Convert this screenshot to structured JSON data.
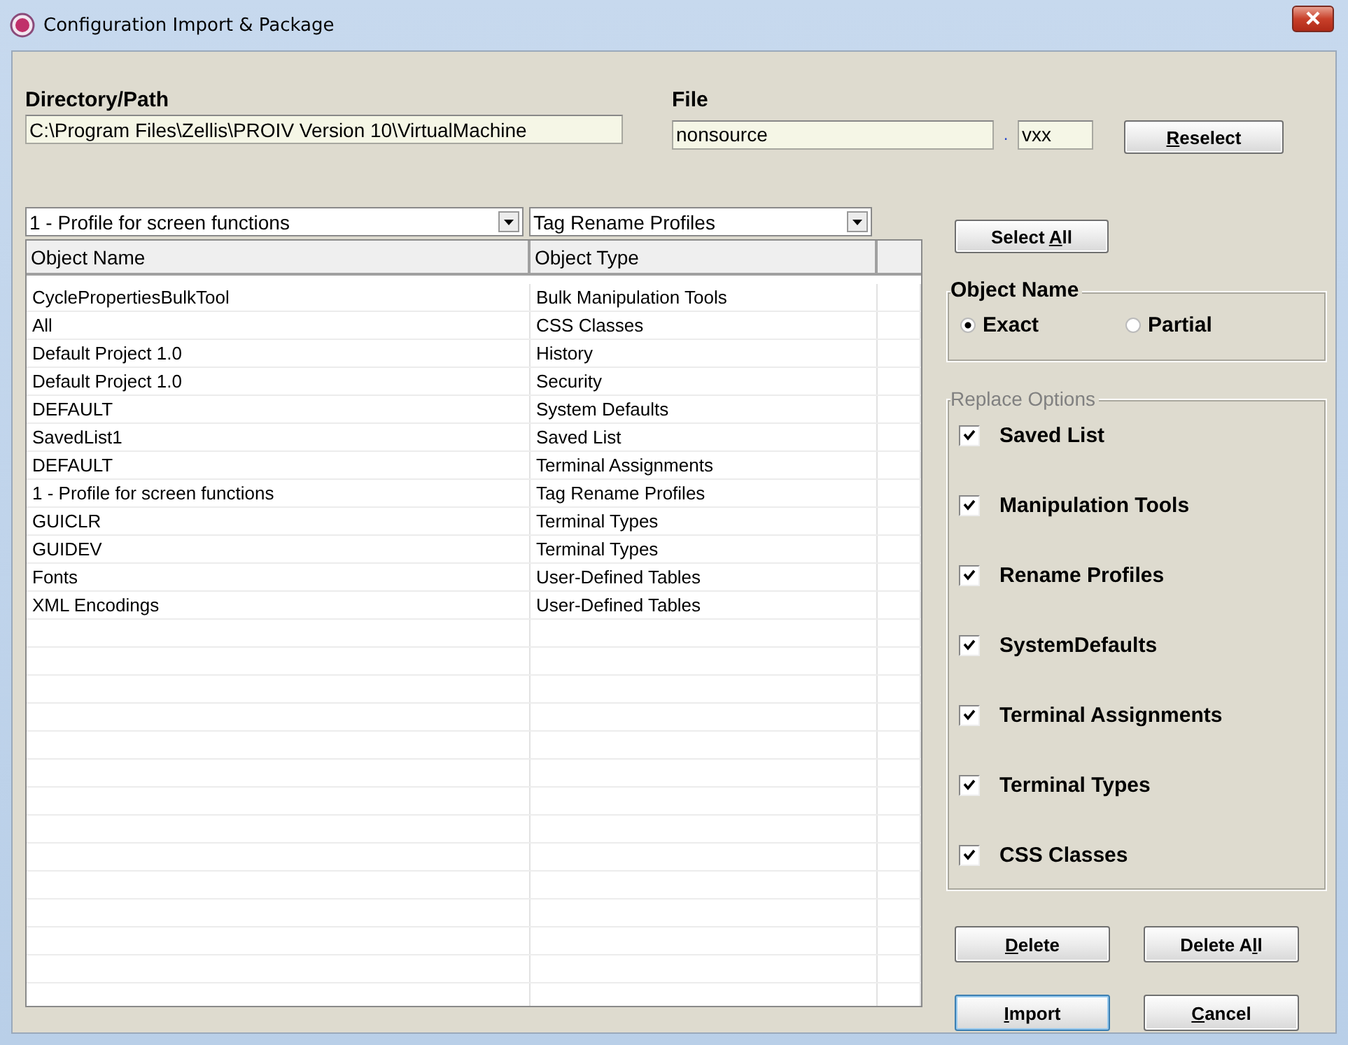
{
  "window": {
    "title": "Configuration Import & Package"
  },
  "directory": {
    "label": "Directory/Path",
    "value": "C:\\Program Files\\Zellis\\PROIV Version 10\\VirtualMachine"
  },
  "file": {
    "label": "File",
    "value": "nonsource",
    "separator": ".",
    "extension": "vxx"
  },
  "reselect_button": {
    "key": "R",
    "post": "eselect"
  },
  "filters": [
    {
      "value": "1 - Profile for screen functions"
    },
    {
      "value": "Tag Rename Profiles"
    }
  ],
  "table": {
    "columns": [
      "Object Name",
      "Object Type"
    ],
    "rows": [
      [
        "CyclePropertiesBulkTool",
        "Bulk Manipulation Tools"
      ],
      [
        "All",
        "CSS Classes"
      ],
      [
        "Default Project 1.0",
        "History"
      ],
      [
        "Default Project 1.0",
        "Security"
      ],
      [
        "DEFAULT",
        "System Defaults"
      ],
      [
        "SavedList1",
        "Saved List"
      ],
      [
        "DEFAULT",
        "Terminal Assignments"
      ],
      [
        "1 - Profile for screen functions",
        "Tag Rename Profiles"
      ],
      [
        "GUICLR",
        "Terminal Types"
      ],
      [
        "GUIDEV",
        "Terminal Types"
      ],
      [
        "Fonts",
        "User-Defined Tables"
      ],
      [
        "XML Encodings",
        "User-Defined Tables"
      ]
    ]
  },
  "select_all_button": {
    "pre": "Select ",
    "key": "A",
    "post": "ll"
  },
  "object_name": {
    "title": "Object Name",
    "options": [
      {
        "label": "Exact",
        "selected": true
      },
      {
        "label": "Partial",
        "selected": false
      }
    ]
  },
  "replace_options": {
    "title": "Replace Options",
    "items": [
      {
        "label": "Saved List",
        "checked": true
      },
      {
        "label": "Manipulation Tools",
        "checked": true
      },
      {
        "label": "Rename Profiles",
        "checked": true
      },
      {
        "label": "SystemDefaults",
        "checked": true
      },
      {
        "label": "Terminal Assignments",
        "checked": true
      },
      {
        "label": "Terminal Types",
        "checked": true
      },
      {
        "label": "CSS Classes",
        "checked": true
      }
    ]
  },
  "buttons": [
    {
      "key": "D",
      "post": "elete",
      "focused": false
    },
    {
      "pre": "Delete A",
      "key": "l",
      "post": "l",
      "focused": false
    },
    {
      "key": "I",
      "post": "mport",
      "focused": true
    },
    {
      "key": "C",
      "post": "ancel",
      "focused": false
    }
  ]
}
